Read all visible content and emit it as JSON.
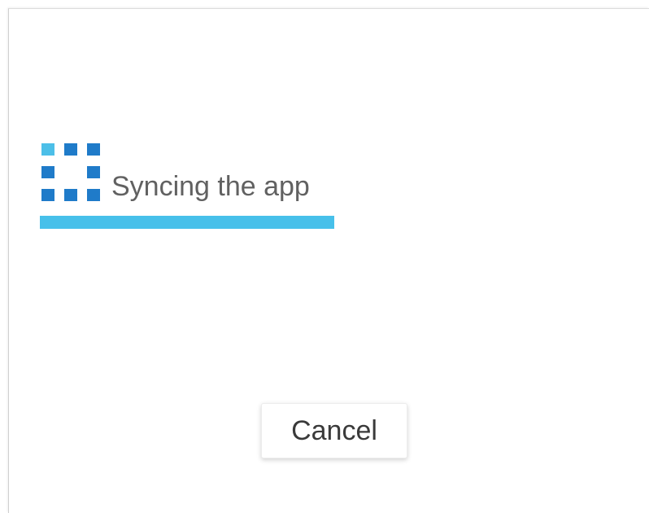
{
  "dialog": {
    "sync_icon": "sync-grid-icon",
    "status_text": "Syncing the app",
    "progress_fraction": 1.0,
    "cancel_label": "Cancel"
  },
  "colors": {
    "icon_light": "#4cbfe8",
    "icon_dark": "#1f7bc9",
    "progress": "#47c0ea",
    "text_primary": "#616161",
    "button_text": "#3a3a3a"
  }
}
